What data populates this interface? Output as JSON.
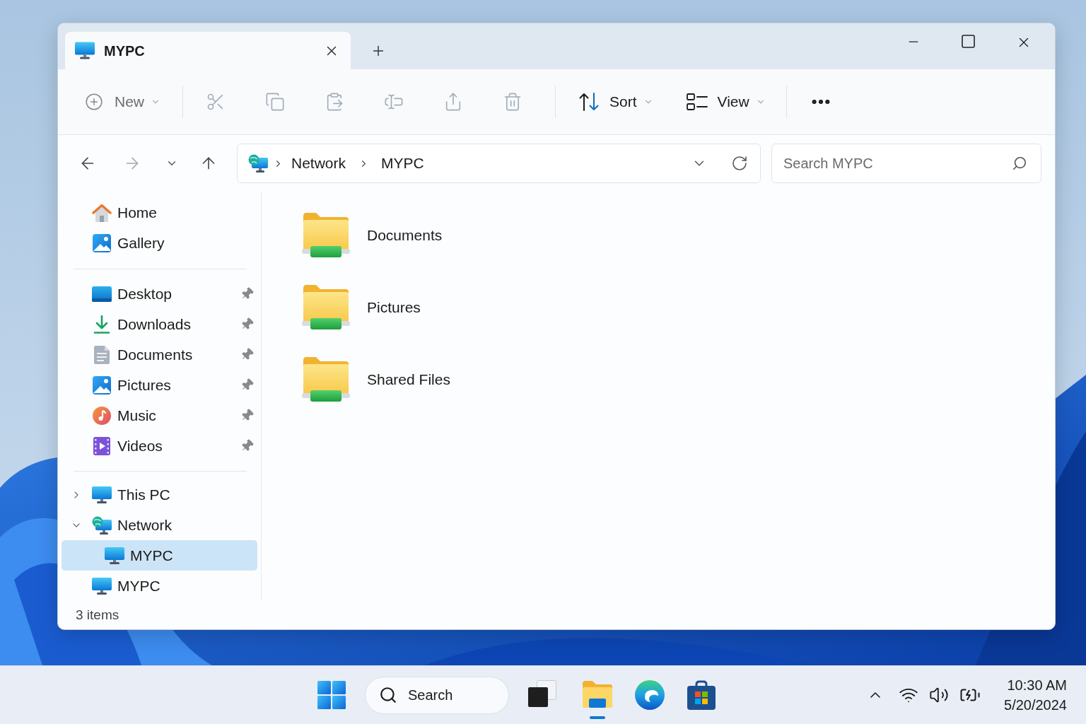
{
  "window": {
    "tabs": [
      {
        "label": "MYPC",
        "selected": true
      }
    ]
  },
  "toolbar": {
    "new": {
      "label": "New",
      "disabled": true
    },
    "actions": [
      {
        "disabled": true
      },
      {
        "disabled": true
      },
      {
        "disabled": true
      },
      {
        "disabled": true
      },
      {
        "disabled": true
      },
      {
        "disabled": true
      }
    ],
    "sort": {
      "label": "Sort",
      "disabled": false
    },
    "view": {
      "label": "View",
      "disabled": false
    }
  },
  "navigation": {
    "back": {
      "disabled": false
    },
    "forward": {
      "disabled": true
    },
    "up": {
      "disabled": false
    }
  },
  "address_bar": {
    "crumbs": [
      "Network",
      "MYPC"
    ]
  },
  "search": {
    "placeholder": "Search MYPC"
  },
  "sidebar": {
    "groups": [
      {
        "items": [
          {
            "label": "Home",
            "selected": false
          },
          {
            "label": "Gallery",
            "selected": false
          }
        ]
      },
      {
        "items": [
          {
            "label": "Desktop",
            "pinned": true,
            "selected": false
          },
          {
            "label": "Downloads",
            "pinned": true,
            "selected": false
          },
          {
            "label": "Documents",
            "pinned": true,
            "selected": false
          },
          {
            "label": "Pictures",
            "pinned": true,
            "selected": false
          },
          {
            "label": "Music",
            "pinned": true,
            "selected": false
          },
          {
            "label": "Videos",
            "pinned": true,
            "selected": false
          }
        ]
      },
      {
        "items": [
          {
            "label": "This PC",
            "expanded": false,
            "selected": false
          },
          {
            "label": "Network",
            "expanded": true,
            "selected": false,
            "children": [
              {
                "label": "MYPC",
                "selected": true
              }
            ]
          },
          {
            "label": "MYPC",
            "selected": false
          }
        ]
      }
    ]
  },
  "content": {
    "items": [
      {
        "name": "Documents",
        "selected": false
      },
      {
        "name": "Pictures",
        "selected": false
      },
      {
        "name": "Shared Files",
        "selected": false
      }
    ]
  },
  "status_bar": {
    "item_count": "3 items"
  },
  "taskbar": {
    "search": {
      "label": "Search"
    },
    "apps": [
      {
        "active": false
      },
      {
        "active": true
      },
      {
        "active": false
      },
      {
        "active": false
      }
    ],
    "clock": {
      "time": "10:30 AM",
      "date": "5/20/2024"
    }
  }
}
